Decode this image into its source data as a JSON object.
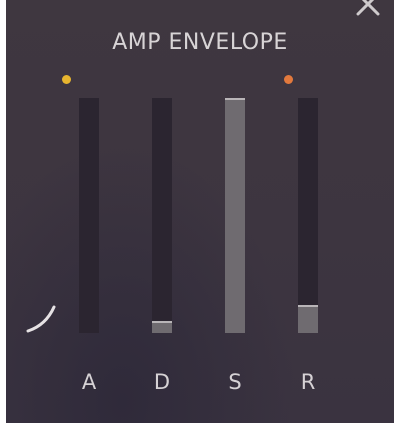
{
  "panel": {
    "title": "AMP ENVELOPE"
  },
  "colors": {
    "attack_dot": "#e7b52f",
    "release_dot": "#e2793d",
    "track": "#2b2530",
    "fill": "#6f6b70",
    "handle": "#b9b5b8"
  },
  "icons": {
    "close": "close-icon",
    "curve": "curve-icon"
  },
  "sliders": [
    {
      "id": "attack",
      "label": "A",
      "level": 0.0
    },
    {
      "id": "decay",
      "label": "D",
      "level": 0.05
    },
    {
      "id": "sustain",
      "label": "S",
      "level": 1.0
    },
    {
      "id": "release",
      "label": "R",
      "level": 0.12
    }
  ]
}
